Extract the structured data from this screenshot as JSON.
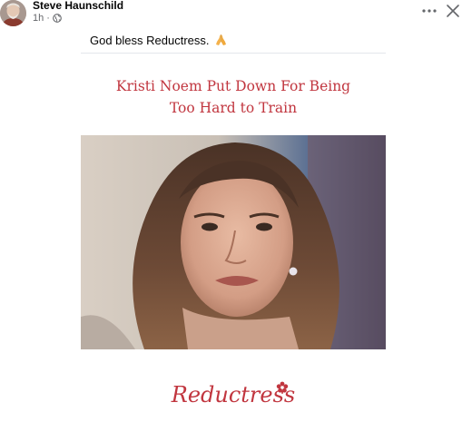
{
  "post": {
    "author": "Steve Haunschild",
    "time": "1h",
    "separator": "·",
    "privacy_icon": "globe-icon",
    "text": "God bless Reductress.",
    "emoji": "🙏"
  },
  "actions": {
    "more_icon": "more-icon",
    "close_icon": "close-icon"
  },
  "card": {
    "headline_line1": "Kristi Noem Put Down For Being",
    "headline_line2": "Too Hard to Train",
    "logo": "Reductress"
  },
  "colors": {
    "headline": "#c1363f",
    "logo": "#c1363f",
    "meta": "#65676b"
  }
}
